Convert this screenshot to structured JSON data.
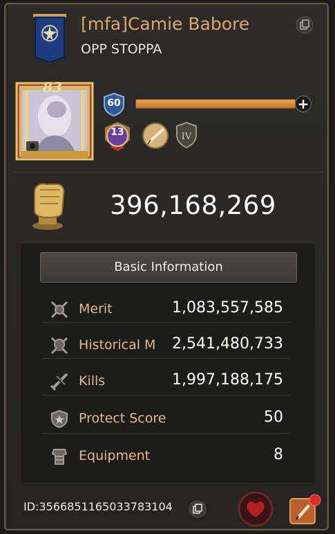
{
  "player": {
    "name": "[mfa]Camie Babore",
    "alliance": "OPP STOPPA",
    "portrait_number": "83",
    "level": "60",
    "level_progress": 1.0,
    "vip_level": "13",
    "rank_numeral": "IV",
    "power": "396,168,269",
    "id": "ID:3566851165033783104"
  },
  "basic_info": {
    "title": "Basic Information",
    "rows": [
      {
        "label": "Merit",
        "value": "1,083,557,585",
        "icon": "crossed-swords-shield-icon"
      },
      {
        "label": "Historical Merit",
        "label_visible": "Historical M",
        "value": "2,541,480,733",
        "icon": "skull-swords-icon"
      },
      {
        "label": "Kills",
        "value": "1,997,188,175",
        "icon": "broken-sword-icon"
      },
      {
        "label": "Protect Score",
        "value": "50",
        "icon": "shield-icon"
      },
      {
        "label": "Equipment",
        "value": "8",
        "icon": "armor-icon"
      }
    ]
  },
  "colors": {
    "name": "#e0a56a",
    "label": "#e6b886",
    "accent_bar": "#d58a3a",
    "panel": "#2a2927"
  }
}
